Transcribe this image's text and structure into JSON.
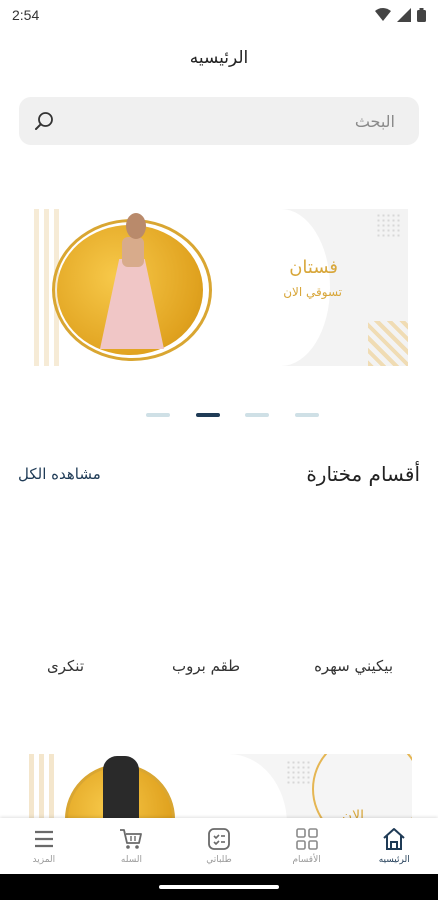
{
  "status": {
    "time": "2:54"
  },
  "app": {
    "title": "الرئيسيه"
  },
  "search": {
    "placeholder": "البحث"
  },
  "banner": {
    "title": "فستان",
    "subtitle": "تسوقي الان"
  },
  "carousel": {
    "pages": 4,
    "active_index": 1
  },
  "featured": {
    "title": "أقسام مختارة",
    "view_all": "مشاهده الكل"
  },
  "categories": [
    {
      "label": "بيكيني سهره"
    },
    {
      "label": "طقم بروب"
    },
    {
      "label": "تنكرى"
    }
  ],
  "banner2": {
    "partial_text": "الان"
  },
  "nav": {
    "items": [
      {
        "label": "الرئيسيه",
        "icon": "home-icon",
        "active": true
      },
      {
        "label": "الأقسام",
        "icon": "grid-icon",
        "active": false
      },
      {
        "label": "طلباتي",
        "icon": "orders-icon",
        "active": false
      },
      {
        "label": "السله",
        "icon": "cart-icon",
        "active": false
      },
      {
        "label": "المزيد",
        "icon": "menu-icon",
        "active": false
      }
    ]
  },
  "colors": {
    "accent": "#1f3b56",
    "gold": "#d8a73b",
    "search_bg": "#f0f0f0"
  }
}
